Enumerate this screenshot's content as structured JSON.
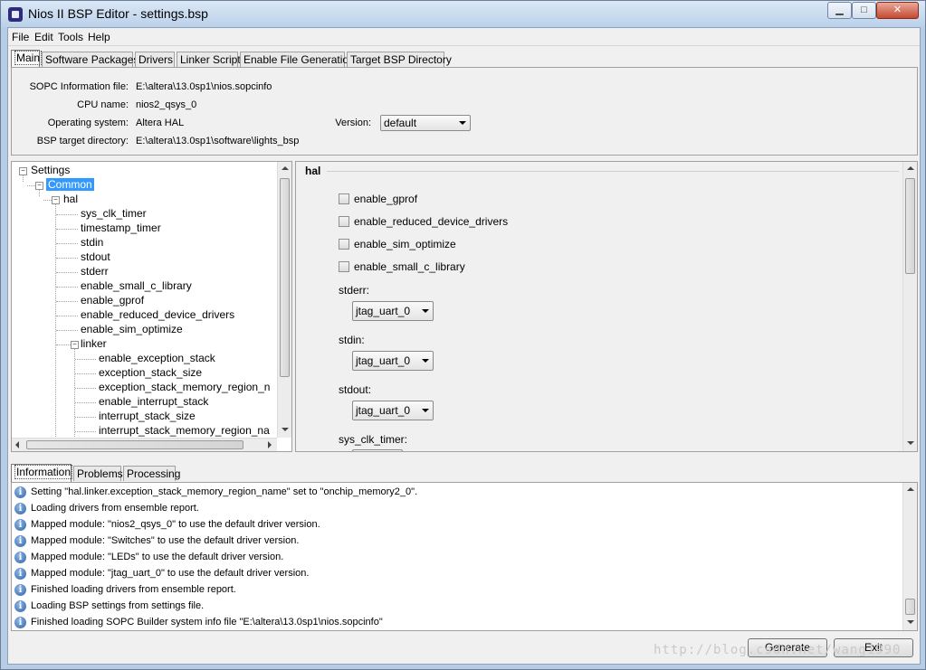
{
  "window": {
    "title": "Nios II BSP Editor - settings.bsp",
    "min_glyph": "▁",
    "max_glyph": "□",
    "close_glyph": "✕"
  },
  "menu": [
    "File",
    "Edit",
    "Tools",
    "Help"
  ],
  "main_tabs": [
    "Main",
    "Software Packages",
    "Drivers",
    "Linker Script",
    "Enable File Generation",
    "Target BSP Directory"
  ],
  "info": {
    "sopc_label": "SOPC Information file:",
    "sopc_value": "E:\\altera\\13.0sp1\\nios.sopcinfo",
    "cpu_label": "CPU name:",
    "cpu_value": "nios2_qsys_0",
    "os_label": "Operating system:",
    "os_value": "Altera HAL",
    "version_label": "Version:",
    "version_value": "default",
    "bsp_label": "BSP target directory:",
    "bsp_value": "E:\\altera\\13.0sp1\\software\\lights_bsp"
  },
  "tree": {
    "root": "Settings",
    "common": "Common",
    "hal": "hal",
    "hal_items": [
      "sys_clk_timer",
      "timestamp_timer",
      "stdin",
      "stdout",
      "stderr",
      "enable_small_c_library",
      "enable_gprof",
      "enable_reduced_device_drivers",
      "enable_sim_optimize"
    ],
    "linker": "linker",
    "linker_items": [
      "enable_exception_stack",
      "exception_stack_size",
      "exception_stack_memory_region_n",
      "enable_interrupt_stack",
      "interrupt_stack_size",
      "interrupt_stack_memory_region_na"
    ]
  },
  "props": {
    "group": "hal",
    "checkboxes": [
      "enable_gprof",
      "enable_reduced_device_drivers",
      "enable_sim_optimize",
      "enable_small_c_library"
    ],
    "stderr_label": "stderr:",
    "stderr_value": "jtag_uart_0",
    "stdin_label": "stdin:",
    "stdin_value": "jtag_uart_0",
    "stdout_label": "stdout:",
    "stdout_value": "jtag_uart_0",
    "sysclk_label": "sys_clk_timer:"
  },
  "bottom_tabs": [
    "Information",
    "Problems",
    "Processing"
  ],
  "log": [
    "Setting \"hal.linker.exception_stack_memory_region_name\" set to \"onchip_memory2_0\".",
    "Loading drivers from ensemble report.",
    "Mapped module: \"nios2_qsys_0\" to use the default driver version.",
    "Mapped module: \"Switches\" to use the default driver version.",
    "Mapped module: \"LEDs\" to use the default driver version.",
    "Mapped module: \"jtag_uart_0\" to use the default driver version.",
    "Finished loading drivers from ensemble report.",
    "Loading BSP settings from settings file.",
    "Finished loading SOPC Builder system info file \"E:\\altera\\13.0sp1\\nios.sopcinfo\""
  ],
  "buttons": {
    "generate": "Generate",
    "exit": "Exit"
  },
  "watermark": "http://blog.csdn.net/wang1990"
}
